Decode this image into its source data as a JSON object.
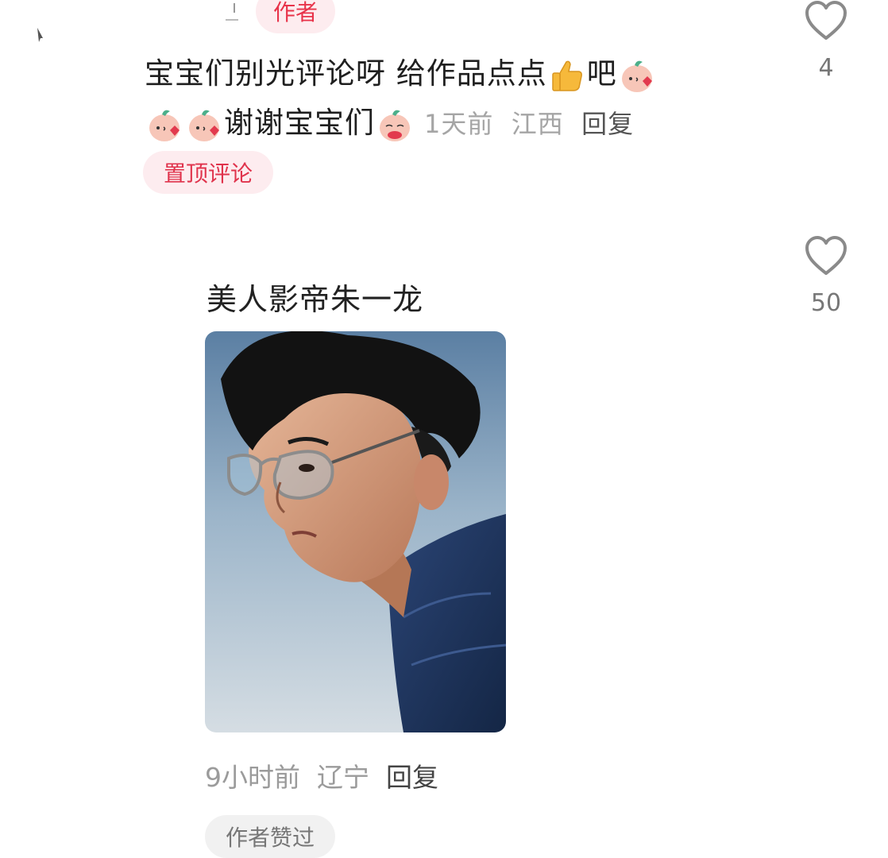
{
  "comments": [
    {
      "author_tag": "作者",
      "text_line1": "宝宝们别光评论呀 给作品点点",
      "text_line1_after": "吧",
      "text_line2": "谢谢宝宝们",
      "time": "1天前",
      "location": "江西",
      "reply_label": "回复",
      "badge": "置顶评论",
      "like_count": "4"
    },
    {
      "username": "美人影帝朱一龙",
      "time": "9小时前",
      "location": "辽宁",
      "reply_label": "回复",
      "badge": "作者赞过",
      "like_count": "50"
    }
  ],
  "icons": {
    "like": "heart-outline-icon",
    "thumb": "thumbs-up-emoji",
    "sticker": "peach-kiss-sticker",
    "sticker2": "peach-shy-sticker"
  },
  "colors": {
    "accent": "#e8334a",
    "author_tag_bg": "#fdecef",
    "muted": "#a5a5a5",
    "heart_stroke": "#8a8a8a"
  }
}
